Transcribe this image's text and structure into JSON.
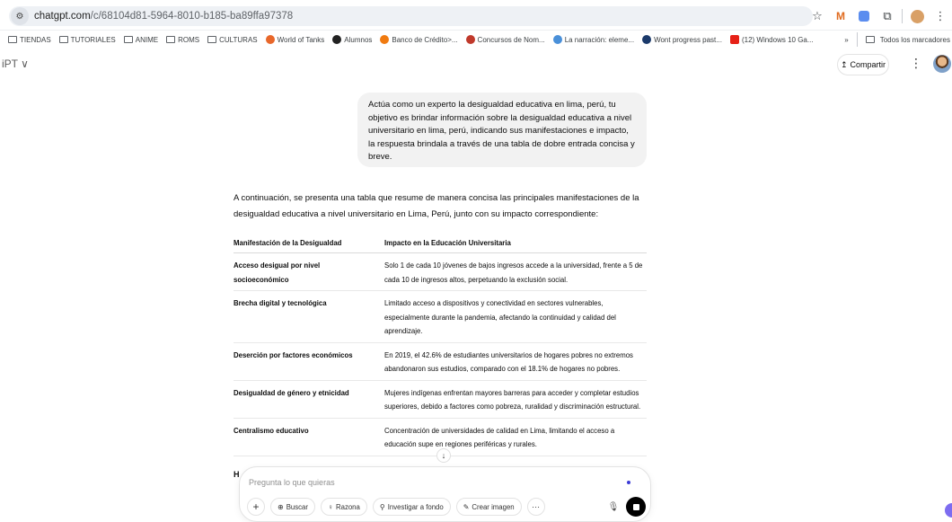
{
  "browser": {
    "url_host": "chatgpt.com",
    "url_path": "/c/68104d81-5964-8010-b185-ba89ffa97378",
    "bookmarks": [
      {
        "label": "TIENDAS",
        "icon": "folder-icon",
        "color": "#5f6368"
      },
      {
        "label": "TUTORIALES",
        "icon": "folder-icon",
        "color": "#5f6368"
      },
      {
        "label": "ANIME",
        "icon": "folder-icon",
        "color": "#5f6368"
      },
      {
        "label": "ROMS",
        "icon": "folder-icon",
        "color": "#5f6368"
      },
      {
        "label": "CULTURAS",
        "icon": "folder-icon",
        "color": "#5f6368"
      },
      {
        "label": "World of Tanks",
        "icon": "world-of-tanks-icon",
        "color": "#e8672a"
      },
      {
        "label": "Alumnos",
        "icon": "alumnos-icon",
        "color": "#222222"
      },
      {
        "label": "Banco de Crédito>...",
        "icon": "bcp-icon",
        "color": "#f07a10"
      },
      {
        "label": "Concursos de Nom...",
        "icon": "concursos-icon",
        "color": "#c0392b"
      },
      {
        "label": "La narración: eleme...",
        "icon": "narracion-icon",
        "color": "#4a90d9"
      },
      {
        "label": "Wont progress past...",
        "icon": "wont-progress-icon",
        "color": "#1b3a6b"
      },
      {
        "label": "(12) Windows 10 Ga...",
        "icon": "youtube-icon",
        "color": "#e62117"
      }
    ],
    "all_bookmarks_label": "Todos los marcadores",
    "overflow_label": "»"
  },
  "header": {
    "model_label": "iPT ∨",
    "share_label": "Compartir",
    "share_icon": "↥",
    "more_icon": "⋮"
  },
  "user_message": "Actúa como un experto la desigualdad educativa en lima, perú, tu objetivo es brindar información sobre la desigualdad educativa a nivel universitario en lima, perú, indicando sus manifestaciones e impacto, la respuesta brindala a través de una tabla de dobre entrada concisa y breve.",
  "assistant": {
    "intro": "A continuación, se presenta una tabla que resume de manera concisa las principales manifestaciones de la desigualdad educativa a nivel universitario en Lima, Perú, junto con su impacto correspondiente:",
    "table": {
      "headers": [
        "Manifestación de la Desigualdad",
        "Impacto en la Educación Universitaria"
      ],
      "rows": [
        [
          "Acceso desigual por nivel socioeconómico",
          "Solo 1 de cada 10 jóvenes de bajos ingresos accede a la universidad, frente a 5 de cada 10 de ingresos altos, perpetuando la exclusión social."
        ],
        [
          "Brecha digital y tecnológica",
          "Limitado acceso a dispositivos y conectividad en sectores vulnerables, especialmente durante la pandemia, afectando la continuidad y calidad del aprendizaje."
        ],
        [
          "Deserción por factores económicos",
          "En 2019, el 42.6% de estudiantes universitarios de hogares pobres no extremos abandonaron sus estudios, comparado con el 18.1% de hogares no pobres."
        ],
        [
          "Desigualdad de género y etnicidad",
          "Mujeres indígenas enfrentan mayores barreras para acceder y completar estudios superiores, debido a factores como pobreza, ruralidad y discriminación estructural."
        ],
        [
          "Centralismo educativo",
          "Concentración de universidades de calidad en Lima, limitando el acceso a educación supe    en regiones periféricas y rurales."
        ]
      ]
    },
    "partial_next_row": "H"
  },
  "composer": {
    "placeholder": "Pregunta lo que quieras",
    "value": "",
    "plus_label": "+",
    "tools": [
      {
        "label": "Buscar",
        "icon": "globe-icon",
        "glyph": "⊕"
      },
      {
        "label": "Razona",
        "icon": "lightbulb-icon",
        "glyph": "♀"
      },
      {
        "label": "Investigar a fondo",
        "icon": "telescope-icon",
        "glyph": "⚲"
      },
      {
        "label": "Crear imagen",
        "icon": "image-brush-icon",
        "glyph": "✎"
      }
    ],
    "more_label": "···"
  },
  "colors": {
    "accent_dot": "#3b3bd6",
    "stop_button": "#000000",
    "bubble": "#f2f2f2"
  }
}
